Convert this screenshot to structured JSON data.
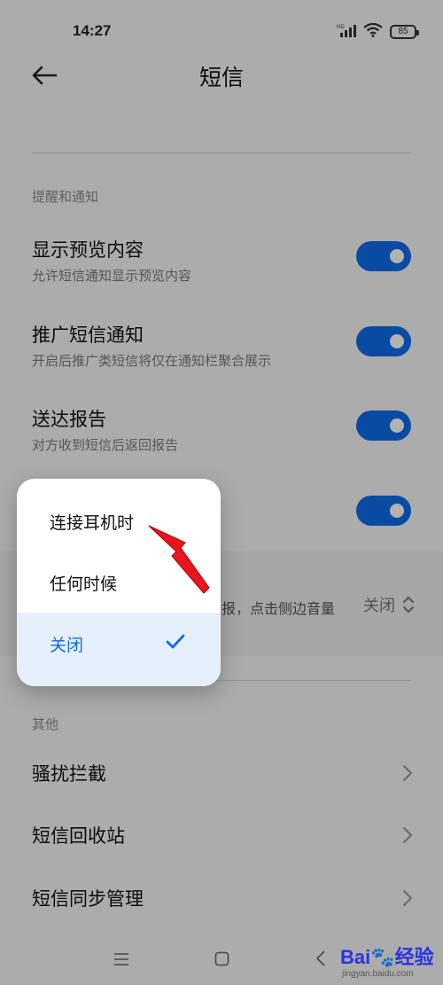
{
  "status_bar": {
    "time": "14:27",
    "battery": "85"
  },
  "header": {
    "title": "短信"
  },
  "sections": {
    "notifications": "提醒和通知",
    "other": "其他"
  },
  "settings": [
    {
      "title": "显示预览内容",
      "subtitle": "允许短信通知显示预览内容",
      "enabled": true
    },
    {
      "title": "推广短信通知",
      "subtitle": "开启后推广类短信将仅在通知栏聚合展示",
      "enabled": true
    },
    {
      "title": "送达报告",
      "subtitle": "对方收到短信后返回报告",
      "enabled": true
    },
    {
      "title": "",
      "subtitle": "",
      "enabled": true
    }
  ],
  "voice_setting": {
    "partial_text": "报，点击侧边音量",
    "value": "关闭"
  },
  "other_items": [
    "骚扰拦截",
    "短信回收站",
    "短信同步管理"
  ],
  "popup": {
    "options": [
      "连接耳机时",
      "任何时候",
      "关闭"
    ],
    "selected": "关闭"
  },
  "watermark": {
    "logo": "Bai🐾经验",
    "url": "jingyan.baidu.com"
  },
  "colors": {
    "accent": "#0d6ce8",
    "arrow": "#e8161c"
  }
}
